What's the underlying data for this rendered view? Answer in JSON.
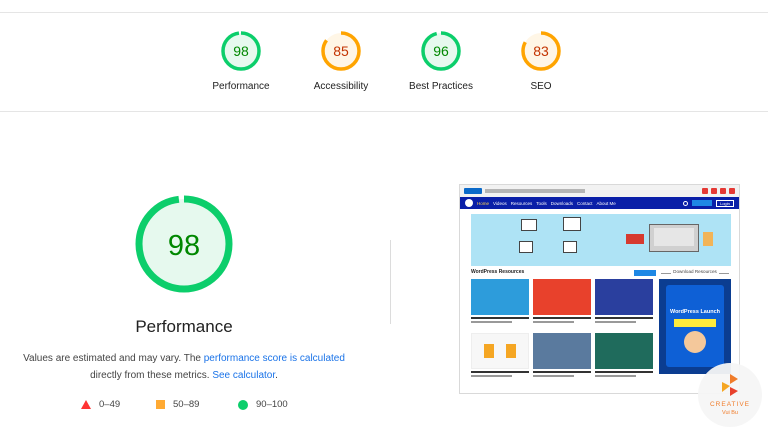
{
  "colors": {
    "pass": "#0cce6b",
    "average": "#ffa400",
    "fail": "#ff3333",
    "link": "#1a73e8"
  },
  "gauges": [
    {
      "score": 98,
      "label": "Performance",
      "status": "pass"
    },
    {
      "score": 85,
      "label": "Accessibility",
      "status": "average"
    },
    {
      "score": 96,
      "label": "Best Practices",
      "status": "pass"
    },
    {
      "score": 83,
      "label": "SEO",
      "status": "average"
    }
  ],
  "main": {
    "score": 98,
    "title": "Performance",
    "desc_1": "Values are estimated and may vary. The ",
    "desc_link_1": "performance score is calculated",
    "desc_2": "directly from these metrics. ",
    "desc_link_2": "See calculator",
    "desc_3": "."
  },
  "legend": [
    {
      "shape": "triangle-icon",
      "range": "0–49"
    },
    {
      "shape": "square-icon",
      "range": "50–89"
    },
    {
      "shape": "circle-icon",
      "range": "90–100"
    }
  ],
  "thumbnail": {
    "nav_items": [
      "Home",
      "Videos",
      "Resources",
      "Tools",
      "Downloads",
      "Contact",
      "About Me"
    ],
    "login": "Login",
    "section_title": "WordPress Resources",
    "downloads_title": "Download Resources",
    "side_heading": "WordPress Launch"
  },
  "watermark": {
    "line1": "CREATIVE",
    "line2": "Vui Bu"
  }
}
